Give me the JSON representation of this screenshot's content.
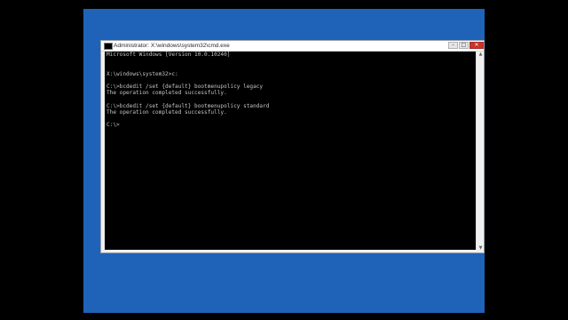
{
  "window": {
    "title": "Administrator: X:\\windows\\system32\\cmd.exe",
    "controls": {
      "minimize": "–",
      "maximize": "□",
      "close": "✕"
    }
  },
  "console": {
    "lines": [
      "Microsoft Windows [Version 10.0.10240]",
      "",
      "",
      "X:\\windows\\system32>c:",
      "",
      "C:\\>bcdedit /set {default} bootmenupolicy legacy",
      "The operation completed successfully.",
      "",
      "C:\\>bcdedit /set {default} bootmenupolicy standard",
      "The operation completed successfully.",
      "",
      "C:\\>"
    ]
  },
  "scrollbar": {
    "up_arrow": "▲",
    "down_arrow": "▼"
  },
  "colors": {
    "desktop": "#1f63b8",
    "console_background": "#000000",
    "console_text": "#c4c4c4",
    "close_button": "#c9352b"
  },
  "icons": {
    "title_icon": "cmd-prompt-icon"
  }
}
